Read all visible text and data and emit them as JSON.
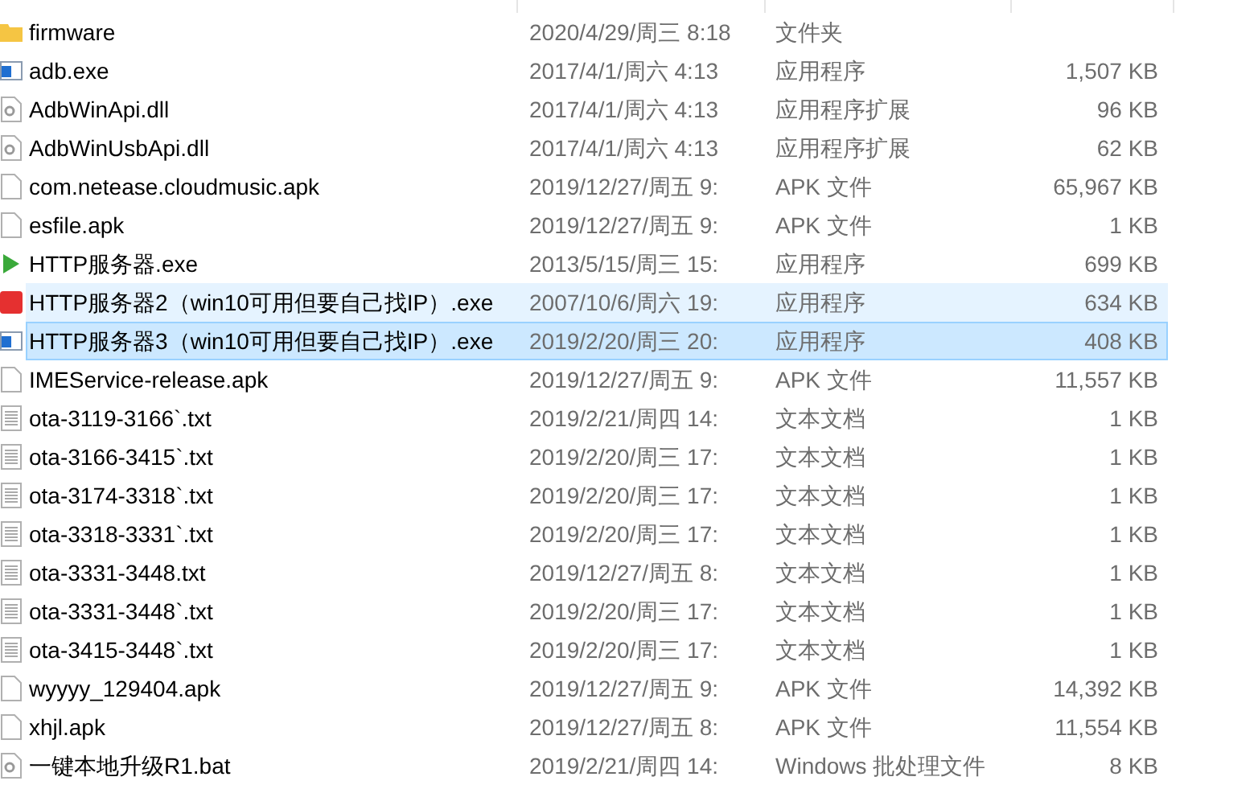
{
  "files": [
    {
      "name": "firmware",
      "date": "2020/4/29/周三 8:18",
      "type": "文件夹",
      "kind": "folder",
      "selected": false,
      "hovered": false
    },
    {
      "name": "adb.exe",
      "date": "2017/4/1/周六 4:13",
      "type": "应用程序",
      "size": "1,507 KB",
      "kind": "exe",
      "selected": false,
      "hovered": false
    },
    {
      "name": "AdbWinApi.dll",
      "date": "2017/4/1/周六 4:13",
      "type": "应用程序扩展",
      "size": "96 KB",
      "kind": "dll",
      "selected": false,
      "hovered": false
    },
    {
      "name": "AdbWinUsbApi.dll",
      "date": "2017/4/1/周六 4:13",
      "type": "应用程序扩展",
      "size": "62 KB",
      "kind": "dll",
      "selected": false,
      "hovered": false
    },
    {
      "name": "com.netease.cloudmusic.apk",
      "date": "2019/12/27/周五 9:",
      "type": "APK 文件",
      "size": "65,967 KB",
      "kind": "file",
      "selected": false,
      "hovered": false
    },
    {
      "name": "esfile.apk",
      "date": "2019/12/27/周五 9:",
      "type": "APK 文件",
      "size": "1 KB",
      "kind": "file",
      "selected": false,
      "hovered": false
    },
    {
      "name": "HTTP服务器.exe",
      "date": "2013/5/15/周三 15:",
      "type": "应用程序",
      "size": "699 KB",
      "kind": "play",
      "selected": false,
      "hovered": false
    },
    {
      "name": "HTTP服务器2（win10可用但要自己找IP）.exe",
      "date": "2007/10/6/周六 19:",
      "type": "应用程序",
      "size": "634 KB",
      "kind": "red",
      "selected": false,
      "hovered": true
    },
    {
      "name": "HTTP服务器3（win10可用但要自己找IP）.exe",
      "date": "2019/2/20/周三 20:",
      "type": "应用程序",
      "size": "408 KB",
      "kind": "exe",
      "selected": true,
      "hovered": false
    },
    {
      "name": "IMEService-release.apk",
      "date": "2019/12/27/周五 9:",
      "type": "APK 文件",
      "size": "11,557 KB",
      "kind": "file",
      "selected": false,
      "hovered": false
    },
    {
      "name": "ota-3119-3166`.txt",
      "date": "2019/2/21/周四 14:",
      "type": "文本文档",
      "size": "1 KB",
      "kind": "txt",
      "selected": false,
      "hovered": false
    },
    {
      "name": "ota-3166-3415`.txt",
      "date": "2019/2/20/周三 17:",
      "type": "文本文档",
      "size": "1 KB",
      "kind": "txt",
      "selected": false,
      "hovered": false
    },
    {
      "name": "ota-3174-3318`.txt",
      "date": "2019/2/20/周三 17:",
      "type": "文本文档",
      "size": "1 KB",
      "kind": "txt",
      "selected": false,
      "hovered": false
    },
    {
      "name": "ota-3318-3331`.txt",
      "date": "2019/2/20/周三 17:",
      "type": "文本文档",
      "size": "1 KB",
      "kind": "txt",
      "selected": false,
      "hovered": false
    },
    {
      "name": "ota-3331-3448.txt",
      "date": "2019/12/27/周五 8:",
      "type": "文本文档",
      "size": "1 KB",
      "kind": "txt",
      "selected": false,
      "hovered": false
    },
    {
      "name": "ota-3331-3448`.txt",
      "date": "2019/2/20/周三 17:",
      "type": "文本文档",
      "size": "1 KB",
      "kind": "txt",
      "selected": false,
      "hovered": false
    },
    {
      "name": "ota-3415-3448`.txt",
      "date": "2019/2/20/周三 17:",
      "type": "文本文档",
      "size": "1 KB",
      "kind": "txt",
      "selected": false,
      "hovered": false
    },
    {
      "name": "wyyyy_129404.apk",
      "date": "2019/12/27/周五 9:",
      "type": "APK 文件",
      "size": "14,392 KB",
      "kind": "file",
      "selected": false,
      "hovered": false
    },
    {
      "name": "xhjl.apk",
      "date": "2019/12/27/周五 8:",
      "type": "APK 文件",
      "size": "11,554 KB",
      "kind": "file",
      "selected": false,
      "hovered": false
    },
    {
      "name": "一键本地升级R1.bat",
      "date": "2019/2/21/周四 14:",
      "type": "Windows 批处理文件",
      "size": "8 KB",
      "kind": "dll",
      "selected": false,
      "hovered": false
    }
  ]
}
